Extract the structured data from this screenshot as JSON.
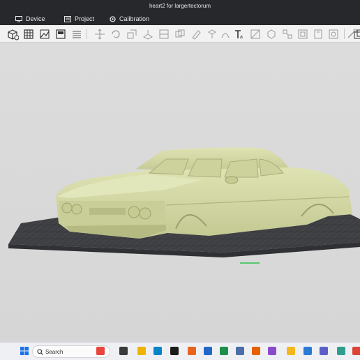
{
  "window": {
    "title": "heart2 for largertectorum"
  },
  "tabs": [
    {
      "label": "Device",
      "icon": "monitor-icon"
    },
    {
      "label": "Project",
      "icon": "project-icon"
    },
    {
      "label": "Calibration",
      "icon": "calibration-icon"
    }
  ],
  "toolbar": {
    "tools": [
      "add-object-icon",
      "plate-grid-icon",
      "auto-arrange-icon",
      "orient-icon",
      "layers-icon",
      "move-icon",
      "rotate-icon",
      "scale-icon",
      "lay-on-face-icon",
      "cut-icon",
      "boolean-icon",
      "support-paint-icon",
      "seam-paint-icon",
      "color-paint-icon",
      "text-icon",
      "measure-icon",
      "assembly-icon",
      "split-objects-icon",
      "split-parts-icon",
      "variable-layer-icon",
      "brim-ears-icon",
      "fuzzy-icon",
      "search-object-icon"
    ]
  },
  "colors": {
    "model": "#d8dca7",
    "model_shadow": "#b9be85",
    "plate": "#3a3c3f",
    "accent": "#0f9d58"
  },
  "taskbar": {
    "search_placeholder": "Search",
    "apps": [
      "windows-start-icon",
      "widgets-gift-icon",
      "file-explorer-icon",
      "folder-icon",
      "edge-icon",
      "bambu-icon",
      "office-icon",
      "mail-icon",
      "excel-icon",
      "calculator-icon",
      "firefox-icon",
      "slicer-icon",
      "notes-icon",
      "store-icon",
      "teams-icon",
      "copilot-icon",
      "chrome-icon"
    ]
  }
}
